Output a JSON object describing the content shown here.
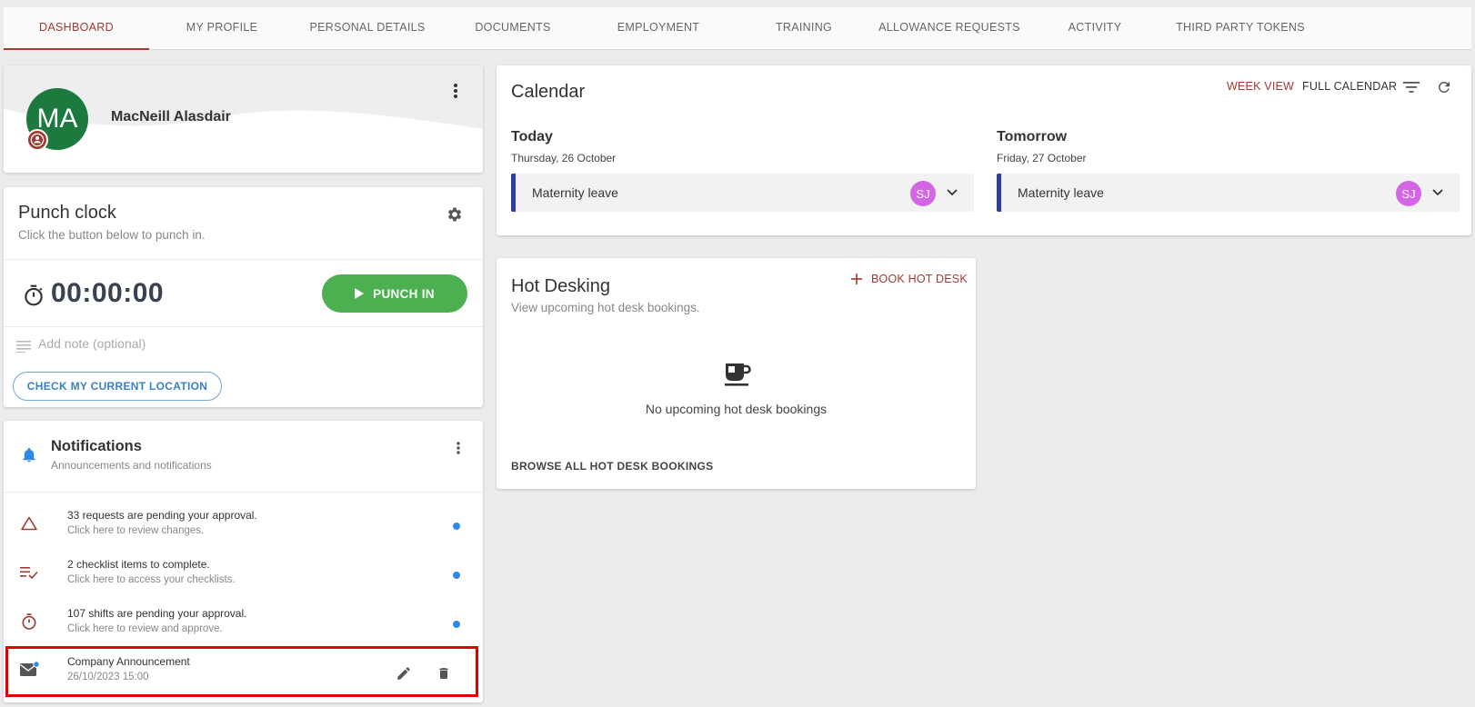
{
  "nav": {
    "tabs": [
      {
        "label": "DASHBOARD",
        "active": true
      },
      {
        "label": "MY PROFILE"
      },
      {
        "label": "PERSONAL DETAILS"
      },
      {
        "label": "DOCUMENTS"
      },
      {
        "label": "EMPLOYMENT"
      },
      {
        "label": "TRAINING"
      },
      {
        "label": "ALLOWANCE REQUESTS"
      },
      {
        "label": "ACTIVITY"
      },
      {
        "label": "THIRD PARTY TOKENS"
      }
    ]
  },
  "profile": {
    "initials": "MA",
    "name": "MacNeill Alasdair",
    "avatar_color": "#1d7a3f",
    "badge_color": "#a13a33"
  },
  "punch_clock": {
    "title": "Punch clock",
    "subtitle": "Click the button below to punch in.",
    "timer": "00:00:00",
    "punch_label": "PUNCH IN",
    "note_placeholder": "Add note (optional)",
    "location_label": "CHECK MY CURRENT LOCATION"
  },
  "notifications": {
    "title": "Notifications",
    "subtitle": "Announcements and notifications",
    "items": [
      {
        "line1": "33 requests are pending your approval.",
        "line2": "Click here to review changes.",
        "icon": "warning-triangle-icon"
      },
      {
        "line1": "2 checklist items to complete.",
        "line2": "Click here to access your checklists.",
        "icon": "checklist-icon"
      },
      {
        "line1": "107 shifts are pending your approval.",
        "line2": "Click here to review and approve.",
        "icon": "stopwatch-icon"
      },
      {
        "line1": "Company Announcement",
        "line2": "26/10/2023 15:00",
        "icon": "mail-icon"
      }
    ]
  },
  "calendar": {
    "title": "Calendar",
    "week_view": "WEEK VIEW",
    "full_calendar": "FULL CALENDAR",
    "days": [
      {
        "label": "Today",
        "date": "Thursday, 26 October",
        "event": "Maternity leave",
        "initials": "SJ"
      },
      {
        "label": "Tomorrow",
        "date": "Friday, 27 October",
        "event": "Maternity leave",
        "initials": "SJ"
      }
    ]
  },
  "hot_desking": {
    "title": "Hot Desking",
    "subtitle": "View upcoming hot desk bookings.",
    "book_label": "BOOK HOT DESK",
    "empty_text": "No upcoming hot desk bookings",
    "browse_label": "BROWSE ALL HOT DESK BOOKINGS"
  },
  "colors": {
    "accent": "#a13a33",
    "success": "#4caf50",
    "event_bar": "#2f3e9e",
    "event_avatar": "#d466e6",
    "unread_dot": "#2e8ae6",
    "link_blue": "#3b7fc4"
  }
}
